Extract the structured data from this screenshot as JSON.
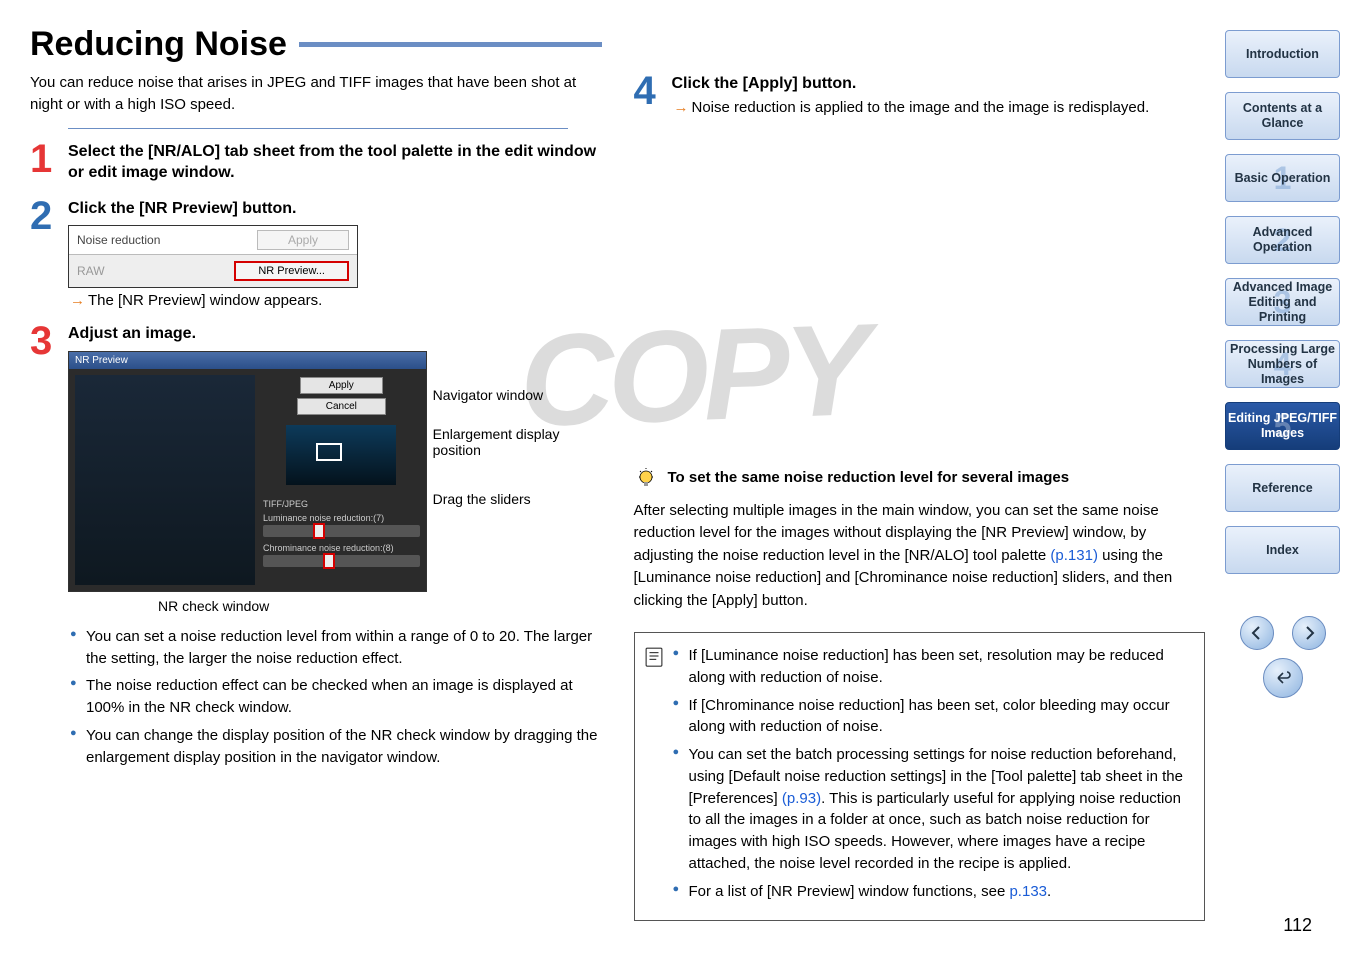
{
  "heading": "Reducing Noise",
  "intro": "You can reduce noise that arises in JPEG and TIFF images that have been shot at night or with a high ISO speed.",
  "step1_title": "Select the [NR/ALO] tab sheet from the tool palette in the edit window or edit image window.",
  "step2_title": "Click the [NR Preview] button.",
  "shot1_label": "Noise reduction",
  "shot1_apply": "Apply",
  "shot1_raw": "RAW",
  "shot1_nrprev": "NR Preview...",
  "step2_result": "The [NR Preview] window appears.",
  "step3_title": "Adjust an image.",
  "shot2_titlebar": "NR Preview",
  "shot2_btn_apply": "Apply",
  "shot2_btn_cancel": "Cancel",
  "shot2_section": "TIFF/JPEG",
  "shot2_slider1": "Luminance noise reduction:(7)",
  "shot2_slider2": "Chrominance noise reduction:(8)",
  "annot_nav": "Navigator window",
  "annot_enl": "Enlargement display position",
  "annot_drag": "Drag the sliders",
  "nr_check": "NR check window",
  "bullets1": "You can set a noise reduction level from within a range of 0 to 20. The larger the setting, the larger the noise reduction effect.",
  "bullets2": "The noise reduction effect can be checked when an image is displayed at 100% in the NR check window.",
  "bullets3": "You can change the display position of the NR check window by dragging the enlargement display position in the navigator window.",
  "step4_title": "Click the [Apply] button.",
  "step4_result": "Noise reduction is applied to the image and the image is redisplayed.",
  "tip_title": "To set the same noise reduction level for several images",
  "tip_body_pre": "After selecting multiple images in the main window, you can set the same noise reduction level for the images without displaying the [NR Preview] window, by adjusting the noise reduction level in the [NR/ALO] tool palette ",
  "tip_link1": "(p.131)",
  "tip_body_post": " using the [Luminance noise reduction] and [Chrominance noise reduction] sliders, and then clicking the [Apply] button.",
  "note1": "If [Luminance noise reduction] has been set, resolution may be reduced along with reduction of noise.",
  "note2": "If [Chrominance noise reduction] has been set, color bleeding may occur along with reduction of noise.",
  "note3_pre": "You can set the batch processing settings for noise reduction beforehand, using [Default noise reduction settings] in the [Tool palette] tab sheet in the [Preferences] ",
  "note3_link": "(p.93)",
  "note3_post": ". This is particularly useful for applying noise reduction to all the images in a folder at once, such as batch noise reduction for images with high ISO speeds. However, where images have a recipe attached, the noise level recorded in the recipe is applied.",
  "note4_pre": "For a list of [NR Preview] window functions, see ",
  "note4_link": "p.133",
  "note4_post": ".",
  "watermark": "COPY",
  "sidebar": {
    "intro": "Introduction",
    "contents": "Contents at a Glance",
    "basic": "Basic Operation",
    "advanced": "Advanced Operation",
    "advimg": "Advanced Image Editing and Printing",
    "proc": "Processing Large Numbers of Images",
    "editing": "Editing JPEG/TIFF Images",
    "reference": "Reference",
    "index": "Index"
  },
  "page_number": "112"
}
